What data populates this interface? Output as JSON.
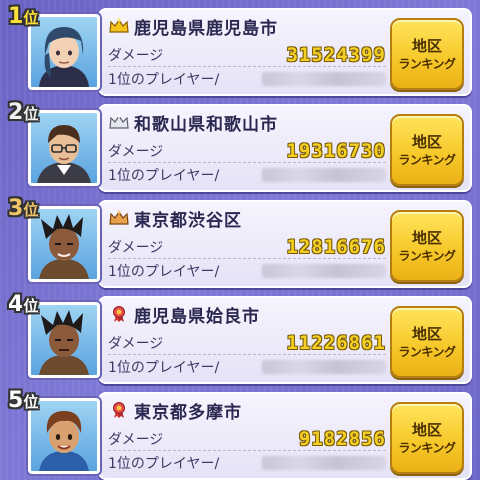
{
  "labels": {
    "damage": "ダメージ",
    "player": "1位のプレイヤー/",
    "button_line1": "地区",
    "button_line2": "ランキング"
  },
  "entries": [
    {
      "rank": "1",
      "rank_suffix": "位",
      "badge": "crown-gold-icon",
      "city": "鹿児島県鹿児島市",
      "damage": "31524399",
      "rank_color": "#ffe03a"
    },
    {
      "rank": "2",
      "rank_suffix": "位",
      "badge": "crown-silver-icon",
      "city": "和歌山県和歌山市",
      "damage": "19316730",
      "rank_color": "#f1f1f1"
    },
    {
      "rank": "3",
      "rank_suffix": "位",
      "badge": "crown-bronze-icon",
      "city": "東京都渋谷区",
      "damage": "12816676",
      "rank_color": "#f2c46a"
    },
    {
      "rank": "4",
      "rank_suffix": "位",
      "badge": "ribbon-medal-icon",
      "city": "鹿児島県姶良市",
      "damage": "11226861",
      "rank_color": "#ffffff"
    },
    {
      "rank": "5",
      "rank_suffix": "位",
      "badge": "ribbon-medal-icon",
      "city": "東京都多摩市",
      "damage": "9182856",
      "rank_color": "#ffffff"
    }
  ]
}
